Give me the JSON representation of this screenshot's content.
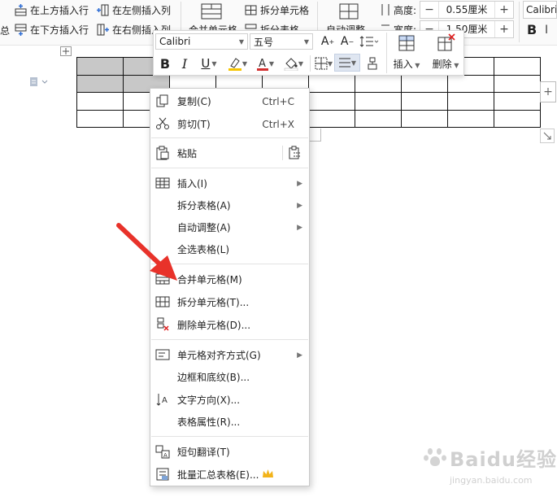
{
  "ribbon": {
    "insert_row_above": "在上方插入行",
    "insert_row_below": "在下方插入行",
    "insert_col_left": "在左侧插入列",
    "insert_col_right": "在右侧插入列",
    "merge_cells": "合并单元格",
    "split_cells": "拆分单元格",
    "split_table": "拆分表格",
    "auto_fit": "自动调整",
    "height_label": "高度:",
    "height_value": "0.55厘米",
    "width_label": "宽度:",
    "width_value": "1.50厘米",
    "font_name": "Calibri",
    "left_edge_char": "总"
  },
  "mini_toolbar": {
    "font_name": "Calibri",
    "font_size": "五号",
    "insert_label": "插入",
    "delete_label": "删除",
    "highlight_color": "#f5c400",
    "font_color": "#d32f2f"
  },
  "table": {
    "rows": 4,
    "cols": 10,
    "selected_cells": [
      [
        0,
        0
      ],
      [
        0,
        1
      ],
      [
        1,
        0
      ],
      [
        1,
        1
      ]
    ]
  },
  "context_menu": {
    "items": [
      {
        "label": "复制(C)",
        "shortcut": "Ctrl+C",
        "icon": "copy-icon"
      },
      {
        "label": "剪切(T)",
        "shortcut": "Ctrl+X",
        "icon": "scissors-icon"
      },
      {
        "label": "粘贴",
        "icon": "paste-icon"
      },
      {
        "label": "插入(I)",
        "icon": "table-insert-icon",
        "submenu": true
      },
      {
        "label": "拆分表格(A)",
        "submenu": true
      },
      {
        "label": "自动调整(A)",
        "submenu": true
      },
      {
        "label": "全选表格(L)"
      },
      {
        "label": "合并单元格(M)",
        "icon": "merge-cells-icon"
      },
      {
        "label": "拆分单元格(T)...",
        "icon": "split-cells-icon"
      },
      {
        "label": "删除单元格(D)...",
        "icon": "delete-cells-icon"
      },
      {
        "label": "单元格对齐方式(G)",
        "icon": "cell-align-icon",
        "submenu": true
      },
      {
        "label": "边框和底纹(B)..."
      },
      {
        "label": "文字方向(X)...",
        "icon": "text-direction-icon"
      },
      {
        "label": "表格属性(R)..."
      },
      {
        "label": "短句翻译(T)",
        "icon": "translate-icon"
      },
      {
        "label": "批量汇总表格(E)...",
        "icon": "summary-icon",
        "badge": "crown-icon"
      }
    ]
  },
  "annotation": {
    "arrow_color": "#e8322a"
  },
  "watermark": {
    "brand": "Baidu经验",
    "url": "jingyan.baidu.com"
  }
}
